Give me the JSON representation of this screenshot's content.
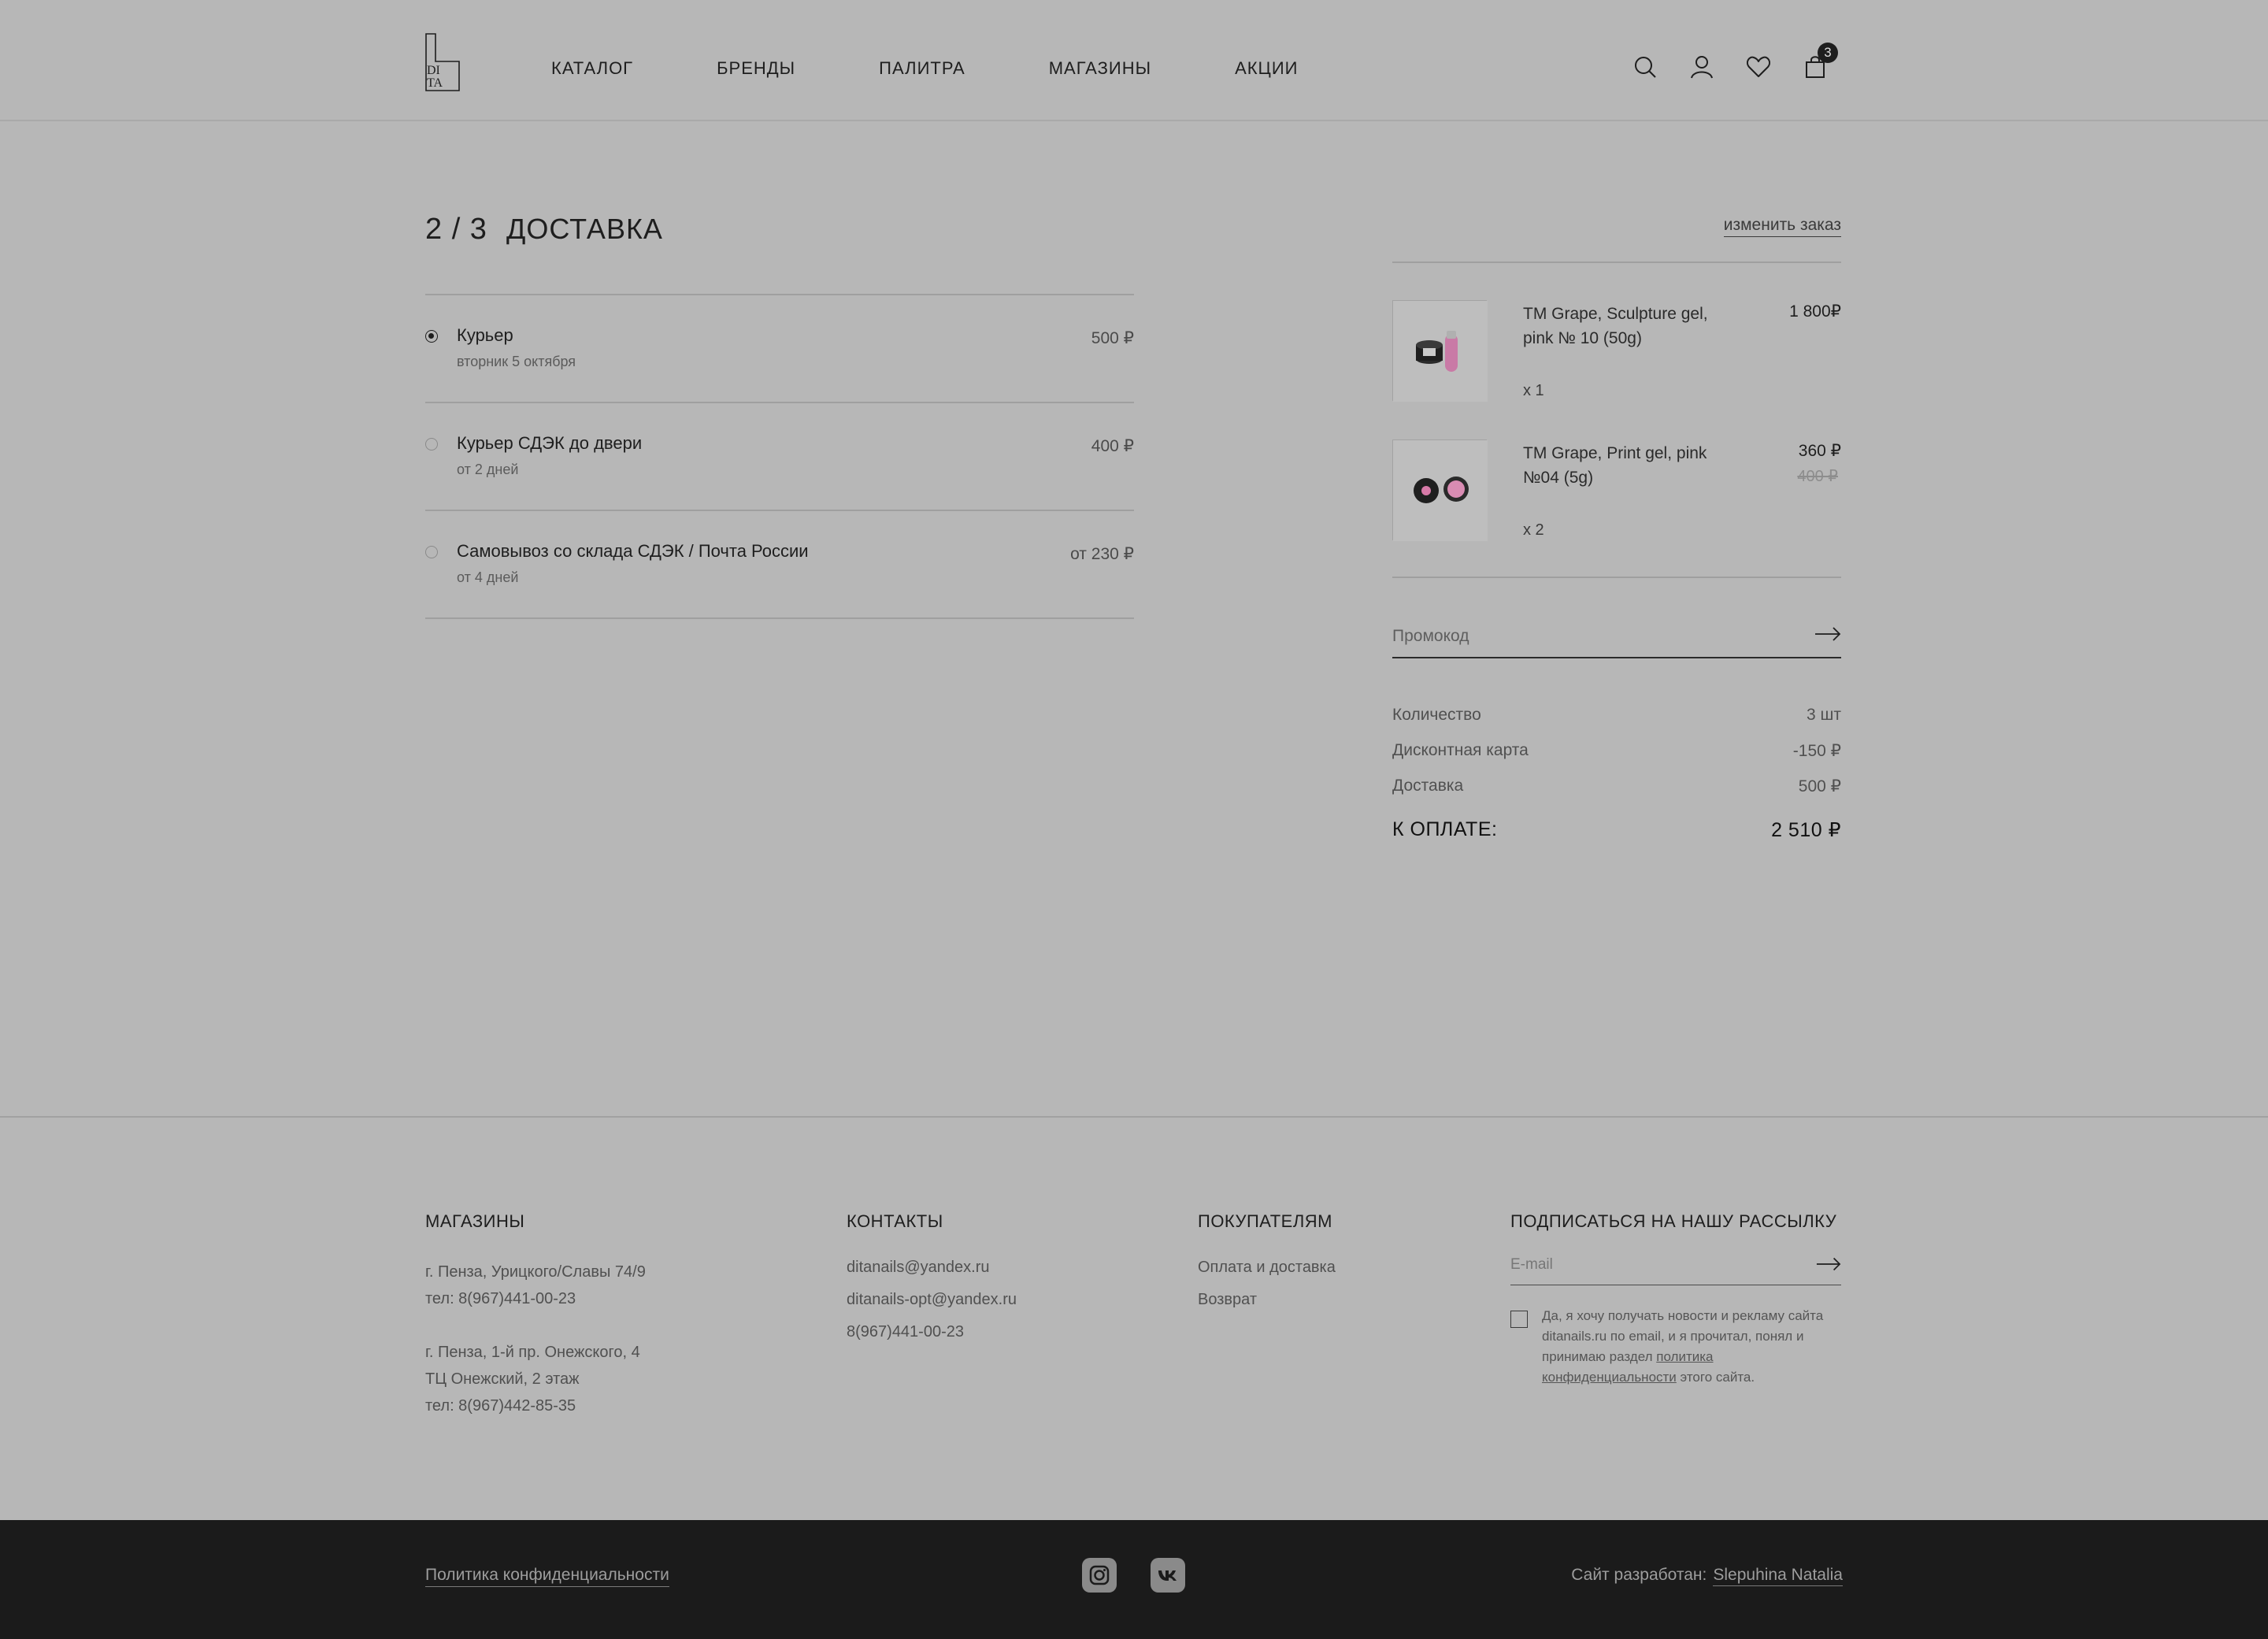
{
  "header": {
    "logo_text_top": "DI",
    "logo_text_bottom": "TA",
    "nav": [
      "КАТАЛОГ",
      "БРЕНДЫ",
      "ПАЛИТРА",
      "МАГАЗИНЫ",
      "АКЦИИ"
    ],
    "cart_count": "3",
    "icons": [
      "search-icon",
      "user-icon",
      "heart-icon",
      "cart-icon"
    ]
  },
  "checkout": {
    "step": "2 / 3",
    "step_name": "ДОСТАВКА",
    "options": [
      {
        "name": "Курьер",
        "sub": "вторник 5 октября",
        "price": "500 ₽",
        "selected": true
      },
      {
        "name": "Курьер СДЭК до двери",
        "sub": "от 2 дней",
        "price": "400 ₽",
        "selected": false
      },
      {
        "name": "Самовывоз со склада СДЭК / Почта России",
        "sub": "от 4 дней",
        "price": "от 230 ₽",
        "selected": false
      }
    ]
  },
  "summary": {
    "change_order": "изменить заказ",
    "products": [
      {
        "name": "TM Grape, Sculpture gel, pink № 10 (50g)",
        "price": "1 800₽",
        "old_price": "",
        "qty": "x 1"
      },
      {
        "name": "TM Grape, Print gel, pink №04 (5g)",
        "price": "360 ₽",
        "old_price": "400 ₽",
        "qty": "x 2"
      }
    ],
    "promo_placeholder": "Промокод",
    "rows": [
      {
        "label": "Количество",
        "value": "3 шт"
      },
      {
        "label": "Дисконтная карта",
        "value": "-150 ₽"
      },
      {
        "label": "Доставка",
        "value": "500 ₽"
      }
    ],
    "total_label": "К ОПЛАТЕ:",
    "total_value": "2 510 ₽"
  },
  "footer": {
    "stores": {
      "title": "МАГАЗИНЫ",
      "store1": [
        "г. Пенза, Урицкого/Славы 74/9",
        "тел: 8(967)441-00-23"
      ],
      "store2": [
        "г. Пенза, 1-й пр. Онежского, 4",
        "ТЦ Онежский, 2 этаж",
        "тел: 8(967)442-85-35"
      ]
    },
    "contacts": {
      "title": "КОНТАКТЫ",
      "items": [
        "ditanails@yandex.ru",
        "ditanails-opt@yandex.ru",
        "8(967)441-00-23"
      ]
    },
    "buyers": {
      "title": "ПОКУПАТЕЛЯМ",
      "items": [
        "Оплата и доставка",
        "Возврат"
      ]
    },
    "newsletter": {
      "title": "ПОДПИСАТЬСЯ НА НАШУ РАССЫЛКУ",
      "email_placeholder": "E-mail",
      "consent_pre": "Да, я хочу получать новости и рекламу сайта ditanails.ru по email, и я прочитал, понял и принимаю раздел ",
      "consent_link": "политика конфиденциальности",
      "consent_post": " этого сайта."
    },
    "bottom": {
      "policy": "Политика конфиденциальности",
      "dev_label": "Сайт разработан:",
      "dev_name": "Slepuhina Natalia",
      "social": [
        "instagram-icon",
        "vk-icon"
      ]
    }
  }
}
